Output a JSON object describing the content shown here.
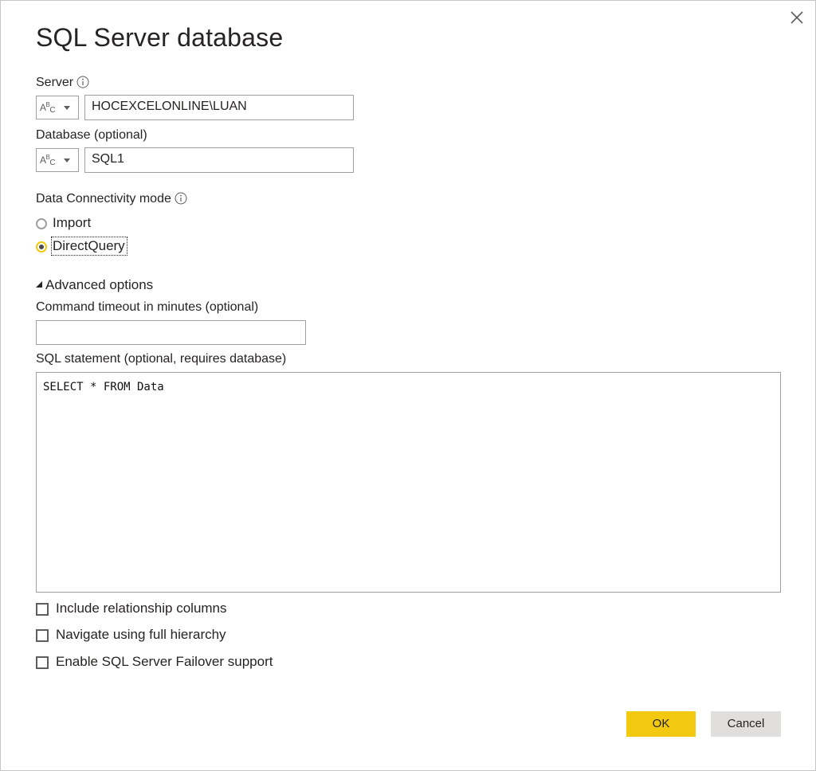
{
  "dialog": {
    "title": "SQL Server database",
    "close_icon": "close-icon"
  },
  "server": {
    "label": "Server",
    "type_icon": "ABC",
    "value": "HOCEXCELONLINE\\LUAN"
  },
  "database": {
    "label": "Database (optional)",
    "type_icon": "ABC",
    "value": "SQL1"
  },
  "connectivity": {
    "label": "Data Connectivity mode",
    "options": [
      {
        "label": "Import",
        "checked": false
      },
      {
        "label": "DirectQuery",
        "checked": true
      }
    ]
  },
  "advanced": {
    "toggle_label": "Advanced options",
    "timeout_label": "Command timeout in minutes (optional)",
    "timeout_value": "",
    "sql_label": "SQL statement (optional, requires database)",
    "sql_value": "SELECT * FROM Data",
    "checkboxes": [
      {
        "label": "Include relationship columns",
        "checked": false
      },
      {
        "label": "Navigate using full hierarchy",
        "checked": false
      },
      {
        "label": "Enable SQL Server Failover support",
        "checked": false
      }
    ]
  },
  "buttons": {
    "ok": "OK",
    "cancel": "Cancel"
  },
  "colors": {
    "accent": "#f2c811",
    "secondary_button": "#e1dfdd",
    "border": "#a19f9d"
  }
}
